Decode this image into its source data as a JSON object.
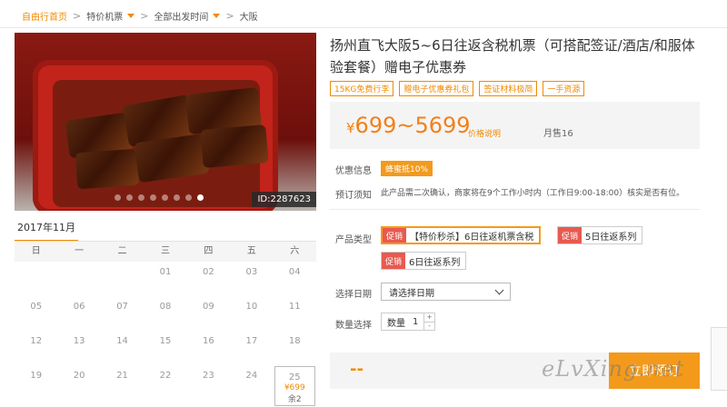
{
  "breadcrumb": {
    "home": "自由行首页",
    "sep": ">",
    "items": [
      "特价机票",
      "全部出发时间"
    ],
    "current": "大阪"
  },
  "photo": {
    "id_label": "ID:2287623",
    "dot_count": 8,
    "active_dot": 7
  },
  "calendar": {
    "month": "2017年11月",
    "weekdays": [
      "日",
      "一",
      "二",
      "三",
      "四",
      "五",
      "六"
    ],
    "rows": [
      [
        "",
        "",
        "",
        "01",
        "02",
        "03",
        "04"
      ],
      [
        "05",
        "06",
        "07",
        "08",
        "09",
        "10",
        "11"
      ],
      [
        "12",
        "13",
        "14",
        "15",
        "16",
        "17",
        "18"
      ],
      [
        "19",
        "20",
        "21",
        "22",
        "23",
        "24",
        "25"
      ]
    ],
    "selected_day": {
      "day": "25",
      "price": "¥699",
      "remain": "余2"
    }
  },
  "product": {
    "title": "扬州直飞大阪5~6日往返含税机票（可搭配签证/酒店/和服体验套餐）赠电子优惠券",
    "tags": [
      "15KG免费行李",
      "赠电子优惠券礼包",
      "签证材料极简",
      "一手资源"
    ],
    "price": "699~5699",
    "currency": "¥",
    "price_link": "价格说明",
    "sold": "月售16",
    "promo_label": "优惠信息",
    "promo_badge": "蜂蜜抵10%",
    "notice_label": "预订须知",
    "notice_text": "此产品需二次确认，商家将在9个工作小时内（工作日9:00-18:00）核实是否有位。",
    "type_label": "产品类型",
    "options": [
      {
        "badge": "促销",
        "text": "【特价秒杀】6日往返机票含税",
        "selected": true
      },
      {
        "badge": "促销",
        "text": "5日往返系列",
        "selected": false
      },
      {
        "badge": "促销",
        "text": "6日往返系列",
        "selected": false
      }
    ],
    "date_label": "选择日期",
    "date_placeholder": "请选择日期",
    "qty_label": "数量选择",
    "qty_field_label": "数量",
    "qty_value": "1",
    "qty_plus": "+",
    "qty_minus": "-",
    "total": "--",
    "buy_label": "立即预订"
  },
  "watermark": "eLvXing.net",
  "colors": {
    "accent": "#f39a1b",
    "price": "#f2801a",
    "badge": "#e85a4f"
  }
}
